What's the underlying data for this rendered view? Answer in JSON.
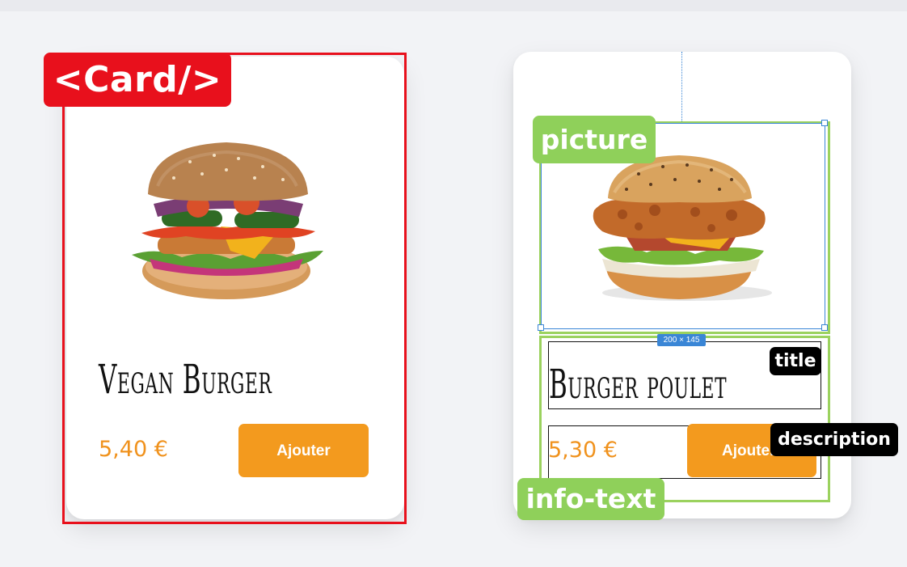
{
  "annotations": {
    "component_tag": "<Card/>",
    "picture_tag": "picture",
    "info_text_tag": "info-text",
    "title_tag": "title",
    "description_tag": "description",
    "dimension_badge": "200 × 145"
  },
  "cards": [
    {
      "title": "Vegan Burger",
      "price": "5,40 €",
      "button_label": "Ajouter",
      "image_icon": "vegan-burger-image"
    },
    {
      "title": "Burger poulet",
      "price": "5,30 €",
      "button_label": "Ajouter",
      "image_icon": "chicken-burger-image"
    }
  ],
  "colors": {
    "card_outline": "#e8101c",
    "annotation_green": "#8fd05a",
    "accent_orange": "#f39a1e",
    "price_orange": "#f0921d",
    "selection_blue": "#3a86d6"
  }
}
